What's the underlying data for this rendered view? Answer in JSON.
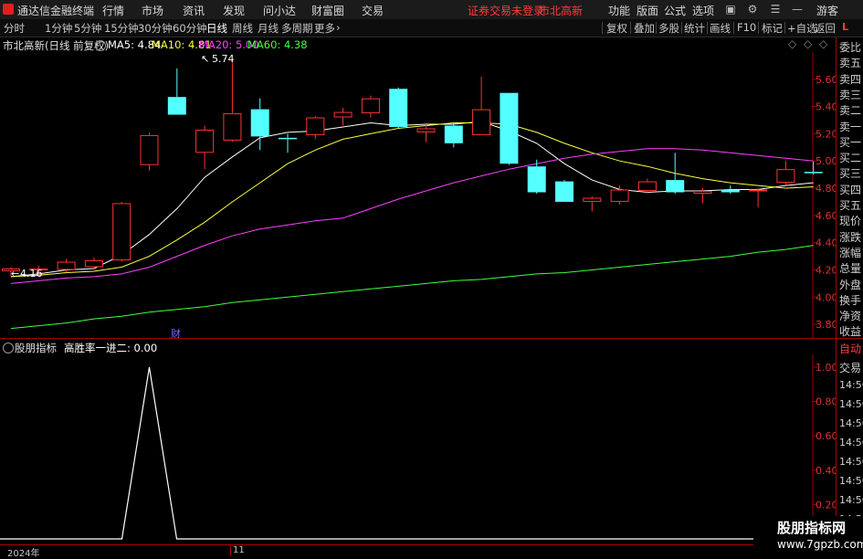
{
  "titlebar": {
    "app_name": "通达信金融终端",
    "menus": [
      "行情",
      "市场",
      "资讯",
      "发现",
      "问小达",
      "财富圈",
      "交易"
    ],
    "status_warning": "证券交易未登录",
    "stock_name": "市北高新",
    "right_menus": [
      "功能",
      "版面",
      "公式",
      "选项"
    ],
    "user": "游客",
    "colors": {
      "warning": "#ff3b3b",
      "bg": "#1b1b1b"
    }
  },
  "toolbar": {
    "periods": [
      "分时",
      "1分钟",
      "5分钟",
      "15分钟",
      "30分钟",
      "60分钟",
      "日线",
      "周线",
      "月线",
      "多周期",
      "更多"
    ],
    "active_period": "日线",
    "more_arrow": "›",
    "right_buttons": [
      "复权",
      "叠加",
      "多股",
      "统计",
      "画线",
      "F10",
      "标记",
      "+自选",
      "返回"
    ]
  },
  "main_chart": {
    "title": "市北高新(日线 前复权)",
    "ma": [
      {
        "label": "MA5: 4.84",
        "color": "#ffffff"
      },
      {
        "label": "MA10: 4.81",
        "color": "#ffff40"
      },
      {
        "label": "MA20: 5.00",
        "color": "#ff40ff"
      },
      {
        "label": "MA60: 4.38",
        "color": "#40ff40"
      }
    ],
    "high_label": "5.74",
    "low_label": "4.16",
    "finance_marker": "财",
    "y_ticks": [
      "5.60",
      "5.40",
      "5.20",
      "5.00",
      "4.80",
      "4.60",
      "4.40",
      "4.20",
      "4.00",
      "3.80"
    ],
    "colors": {
      "up": "#ff3232",
      "down": "#54ffff",
      "axis": "#a00000"
    }
  },
  "chart_data": [
    {
      "type": "candlestick",
      "title": "市北高新(日线 前复权)",
      "ylim": [
        3.7,
        5.8
      ],
      "y_ticks": [
        3.8,
        4.0,
        4.2,
        4.4,
        4.6,
        4.8,
        5.0,
        5.2,
        5.4,
        5.6
      ],
      "candles": [
        {
          "o": 4.19,
          "h": 4.22,
          "l": 4.15,
          "c": 4.21
        },
        {
          "o": 4.2,
          "h": 4.23,
          "l": 4.16,
          "c": 4.21
        },
        {
          "o": 4.2,
          "h": 4.28,
          "l": 4.18,
          "c": 4.26
        },
        {
          "o": 4.22,
          "h": 4.29,
          "l": 4.2,
          "c": 4.27
        },
        {
          "o": 4.27,
          "h": 4.7,
          "l": 4.26,
          "c": 4.69
        },
        {
          "o": 4.97,
          "h": 5.21,
          "l": 4.93,
          "c": 5.19
        },
        {
          "o": 5.47,
          "h": 5.68,
          "l": 5.34,
          "c": 5.34
        },
        {
          "o": 5.06,
          "h": 5.26,
          "l": 4.94,
          "c": 5.23
        },
        {
          "o": 5.15,
          "h": 5.74,
          "l": 5.14,
          "c": 5.35
        },
        {
          "o": 5.38,
          "h": 5.46,
          "l": 5.08,
          "c": 5.18
        },
        {
          "o": 5.17,
          "h": 5.2,
          "l": 5.06,
          "c": 5.16
        },
        {
          "o": 5.19,
          "h": 5.33,
          "l": 5.16,
          "c": 5.32
        },
        {
          "o": 5.32,
          "h": 5.39,
          "l": 5.26,
          "c": 5.36
        },
        {
          "o": 5.35,
          "h": 5.48,
          "l": 5.32,
          "c": 5.46
        },
        {
          "o": 5.53,
          "h": 5.54,
          "l": 5.24,
          "c": 5.25
        },
        {
          "o": 5.21,
          "h": 5.27,
          "l": 5.14,
          "c": 5.24
        },
        {
          "o": 5.26,
          "h": 5.28,
          "l": 5.1,
          "c": 5.13
        },
        {
          "o": 5.19,
          "h": 5.62,
          "l": 5.19,
          "c": 5.38
        },
        {
          "o": 5.5,
          "h": 5.5,
          "l": 4.97,
          "c": 4.98
        },
        {
          "o": 4.96,
          "h": 5.01,
          "l": 4.76,
          "c": 4.77
        },
        {
          "o": 4.85,
          "h": 4.86,
          "l": 4.7,
          "c": 4.7
        },
        {
          "o": 4.7,
          "h": 4.74,
          "l": 4.63,
          "c": 4.73
        },
        {
          "o": 4.7,
          "h": 4.82,
          "l": 4.68,
          "c": 4.79
        },
        {
          "o": 4.78,
          "h": 4.87,
          "l": 4.76,
          "c": 4.85
        },
        {
          "o": 4.86,
          "h": 5.06,
          "l": 4.76,
          "c": 4.77
        },
        {
          "o": 4.76,
          "h": 4.8,
          "l": 4.69,
          "c": 4.78
        },
        {
          "o": 4.79,
          "h": 4.82,
          "l": 4.76,
          "c": 4.77
        },
        {
          "o": 4.78,
          "h": 4.8,
          "l": 4.66,
          "c": 4.79
        },
        {
          "o": 4.84,
          "h": 5.0,
          "l": 4.82,
          "c": 4.94
        },
        {
          "o": 4.92,
          "h": 5.0,
          "l": 4.9,
          "c": 4.91
        }
      ],
      "series": [
        {
          "name": "MA5",
          "color": "#ffffff",
          "values": [
            4.15,
            4.17,
            4.2,
            4.21,
            4.31,
            4.46,
            4.65,
            4.88,
            5.03,
            5.17,
            5.21,
            5.22,
            5.25,
            5.28,
            5.26,
            5.27,
            5.27,
            5.29,
            5.22,
            5.13,
            4.98,
            4.86,
            4.79,
            4.77,
            4.78,
            4.78,
            4.79,
            4.79,
            4.82,
            4.84
          ]
        },
        {
          "name": "MA10",
          "color": "#ffff40",
          "values": [
            4.15,
            4.16,
            4.18,
            4.19,
            4.22,
            4.3,
            4.42,
            4.55,
            4.7,
            4.84,
            4.98,
            5.08,
            5.16,
            5.2,
            5.24,
            5.26,
            5.28,
            5.28,
            5.27,
            5.21,
            5.13,
            5.06,
            5.0,
            4.96,
            4.91,
            4.87,
            4.84,
            4.82,
            4.8,
            4.81
          ]
        },
        {
          "name": "MA20",
          "color": "#ff40ff",
          "values": [
            4.1,
            4.12,
            4.14,
            4.15,
            4.17,
            4.22,
            4.3,
            4.38,
            4.45,
            4.5,
            4.53,
            4.56,
            4.58,
            4.65,
            4.72,
            4.78,
            4.84,
            4.89,
            4.94,
            4.98,
            5.02,
            5.05,
            5.07,
            5.09,
            5.09,
            5.08,
            5.06,
            5.04,
            5.02,
            5.0
          ]
        },
        {
          "name": "MA60",
          "color": "#40ff40",
          "values": [
            3.77,
            3.79,
            3.81,
            3.84,
            3.86,
            3.89,
            3.91,
            3.93,
            3.96,
            3.98,
            4.0,
            4.02,
            4.04,
            4.06,
            4.08,
            4.1,
            4.12,
            4.13,
            4.15,
            4.17,
            4.18,
            4.2,
            4.22,
            4.24,
            4.26,
            4.28,
            4.3,
            4.33,
            4.35,
            4.38
          ]
        }
      ]
    },
    {
      "type": "line",
      "title": "股朋指标  高胜率一进二: 0.00",
      "ylim": [
        0,
        1
      ],
      "y_ticks": [
        0.2,
        0.4,
        0.6,
        0.8,
        1.0
      ],
      "series": [
        {
          "name": "高胜率一进二",
          "color": "#ffffff",
          "values": [
            0,
            0,
            0,
            0,
            0,
            1,
            0,
            0,
            0,
            0,
            0,
            0,
            0,
            0,
            0,
            0,
            0,
            0,
            0,
            0,
            0,
            0,
            0,
            0,
            0,
            0,
            0,
            0,
            0,
            0
          ]
        }
      ]
    }
  ],
  "indicator": {
    "label": "股朋指标",
    "formula": "高胜率一进二: 0.00",
    "y_ticks": [
      "1.00",
      "0.80",
      "0.60",
      "0.40",
      "0.20"
    ]
  },
  "right_panel": {
    "upper_items": [
      "委比",
      "卖五",
      "卖四",
      "卖三",
      "卖二",
      "卖一",
      "买一",
      "买二",
      "买三",
      "买四",
      "买五",
      "现价",
      "涨跌",
      "涨幅",
      "总量",
      "外盘",
      "换手",
      "净资",
      "收益"
    ],
    "lower_items": [
      "自动",
      "交易",
      "14:56",
      "14:56",
      "14:56",
      "14:56",
      "14:56",
      "14:56",
      "14:56",
      "14:56"
    ],
    "top_badge": "L"
  },
  "bottom": {
    "year_label": "2024年",
    "month_label": "11"
  },
  "watermark": {
    "line1": "股朋指标网",
    "line2": "www.7gpzb.com"
  }
}
